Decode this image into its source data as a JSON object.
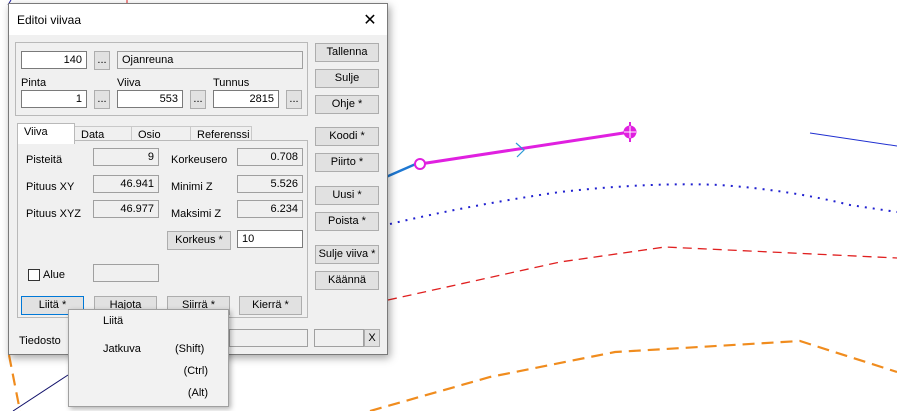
{
  "dialog": {
    "title": "Editoi viivaa",
    "code_value": "140",
    "code_name": "Ojanreuna",
    "browse_label": "...",
    "pinta_label": "Pinta",
    "pinta_value": "1",
    "viiva_label": "Viiva",
    "viiva_value": "553",
    "tunnus_label": "Tunnus",
    "tunnus_value": "2815",
    "tabs": [
      "Viiva",
      "Data",
      "Osio",
      "Referenssi"
    ],
    "stats": {
      "pisteita_label": "Pisteitä",
      "pisteita_value": "9",
      "pituus_xy_label": "Pituus XY",
      "pituus_xy_value": "46.941",
      "pituus_xyz_label": "Pituus XYZ",
      "pituus_xyz_value": "46.977",
      "korkeusero_label": "Korkeusero",
      "korkeusero_value": "0.708",
      "minimi_z_label": "Minimi Z",
      "minimi_z_value": "5.526",
      "maksimi_z_label": "Maksimi Z",
      "maksimi_z_value": "6.234",
      "korkeus_button": "Korkeus *",
      "korkeus_value": "10"
    },
    "alue_label": "Alue",
    "bottom_buttons": [
      "Liitä *",
      "Hajota",
      "Siirrä *",
      "Kierrä *"
    ],
    "tiedosto_label": "Tiedosto",
    "tiedosto_close": "X",
    "right_buttons": [
      "Tallenna",
      "Sulje",
      "Ohje *",
      "Koodi *",
      "Piirto *",
      "Uusi *",
      "Poista *",
      "Sulje viiva *",
      "Käännä"
    ]
  },
  "context_menu": {
    "title": "Liitä",
    "items": [
      {
        "label": "Jatkuva",
        "key": "(Shift)"
      },
      {
        "label": "",
        "key": "(Ctrl)"
      },
      {
        "label": "",
        "key": "(Alt)"
      }
    ]
  },
  "colors": {
    "selected_line": "#e020e0",
    "blue_line": "#1e78d2",
    "dotted_blue": "#2020d0",
    "red_dashed": "#e02020",
    "orange_dashed": "#f08c1e"
  }
}
